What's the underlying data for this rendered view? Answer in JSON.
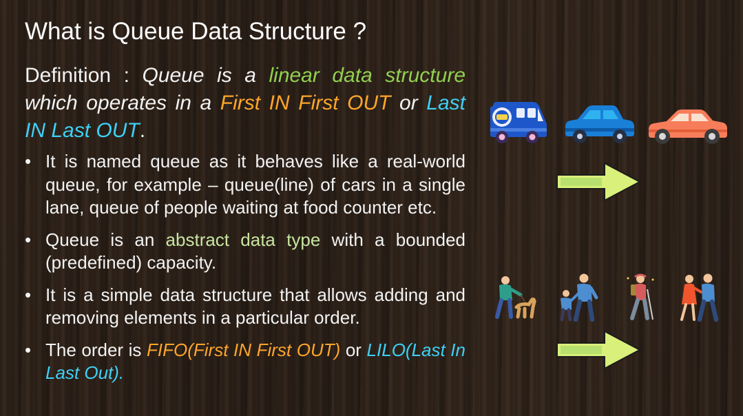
{
  "title": "What is Queue Data Structure ?",
  "definition": {
    "lead": "Definition : ",
    "p1": "Queue is a ",
    "p2": "linear data structure",
    "p3": " which operates in a ",
    "p4": "First IN First OUT",
    "p5": " or ",
    "p6": "Last IN Last OUT",
    "p7": "."
  },
  "bullets": [
    {
      "marker": "•",
      "text": "It is named queue as it behaves like a real-world queue, for example – queue(line) of cars in a single lane, queue of people waiting at food counter etc."
    },
    {
      "marker": "•",
      "pre": "Queue is an ",
      "hl": "abstract data type",
      "post": " with a bounded (predefined) capacity."
    },
    {
      "marker": "•",
      "text": "It is a simple data structure that allows adding and removing elements in a particular order."
    },
    {
      "marker": "•",
      "pre": "The order is ",
      "hl1": "FIFO(First IN First OUT)",
      "mid": " or ",
      "hl2": "LILO(Last In Last Out)."
    }
  ],
  "illustrations": {
    "cars": [
      "van-icon",
      "blue-car-icon",
      "orange-car-icon"
    ],
    "people": [
      "person-with-dog-icon",
      "parent-child-icon",
      "hiker-icon",
      "couple-icon"
    ],
    "arrows": [
      "right-arrow-icon",
      "right-arrow-icon"
    ]
  },
  "colors": {
    "green": "#92d050",
    "orange": "#ffa62b",
    "cyan": "#3fd0f5",
    "olive": "#c7e5a0",
    "arrow_fill": "#d9f07a"
  }
}
